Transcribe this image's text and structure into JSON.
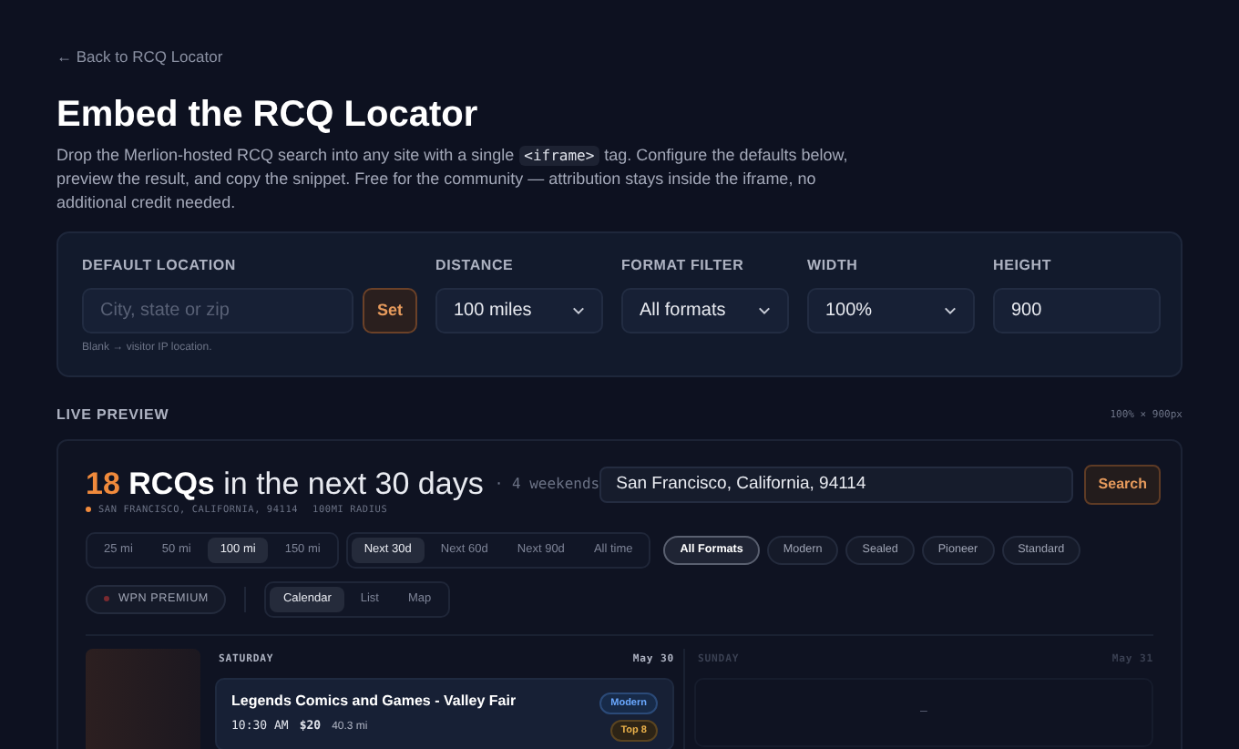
{
  "back_link": "← Back to RCQ Locator",
  "title": "Embed the RCQ Locator",
  "description": {
    "before": "Drop the Merlion-hosted RCQ search into any site with a single",
    "code": "<iframe>",
    "after": "tag. Configure the defaults below, preview the result, and copy the snippet. Free for the community — attribution stays inside the iframe, no additional credit needed."
  },
  "config": {
    "fields": [
      {
        "kind": "text",
        "label": "DEFAULT LOCATION",
        "placeholder": "City, state or zip",
        "button": "Set",
        "hint": "Blank → visitor IP location."
      },
      {
        "kind": "select",
        "label": "DISTANCE",
        "value": "100 miles"
      },
      {
        "kind": "select",
        "label": "FORMAT FILTER",
        "value": "All formats"
      },
      {
        "kind": "select",
        "label": "WIDTH",
        "value": "100%"
      },
      {
        "kind": "number",
        "label": "HEIGHT",
        "value": "900"
      }
    ]
  },
  "preview": {
    "label": "LIVE PREVIEW",
    "size": "100% × 900px",
    "count": "18",
    "heading_bold": "RCQs",
    "heading_rest": "in the next 30 days",
    "weekends": "· 4 weekends",
    "location": "SAN FRANCISCO, CALIFORNIA, 94114",
    "radius": "100MI RADIUS",
    "search": {
      "value": "San Francisco, California, 94114",
      "button": "Search"
    },
    "distance_options": [
      {
        "label": "25 mi",
        "selected": false
      },
      {
        "label": "50 mi",
        "selected": false
      },
      {
        "label": "100 mi",
        "selected": true
      },
      {
        "label": "150 mi",
        "selected": false
      }
    ],
    "time_options": [
      {
        "label": "Next 30d",
        "selected": true
      },
      {
        "label": "Next 60d",
        "selected": false
      },
      {
        "label": "Next 90d",
        "selected": false
      },
      {
        "label": "All time",
        "selected": false
      }
    ],
    "format_options": [
      {
        "label": "All Formats",
        "selected": true
      },
      {
        "label": "Modern",
        "selected": false
      },
      {
        "label": "Sealed",
        "selected": false
      },
      {
        "label": "Pioneer",
        "selected": false
      },
      {
        "label": "Standard",
        "selected": false
      }
    ],
    "premium": {
      "label": "WPN PREMIUM",
      "on": false
    },
    "view_options": [
      {
        "label": "Calendar",
        "selected": true
      },
      {
        "label": "List",
        "selected": false
      },
      {
        "label": "Map",
        "selected": false
      }
    ],
    "calendar": {
      "days": [
        {
          "weekday": "SATURDAY",
          "date": "May 30",
          "dimmed": false,
          "events": [
            {
              "name": "Legends Comics and Games - Valley Fair",
              "time": "10:30 AM",
              "price": "$20",
              "distance": "40.3 mi",
              "format": "Modern",
              "tier": "Top 8"
            }
          ]
        },
        {
          "weekday": "SUNDAY",
          "date": "May 31",
          "dimmed": true,
          "empty_mark": "–"
        }
      ]
    }
  }
}
